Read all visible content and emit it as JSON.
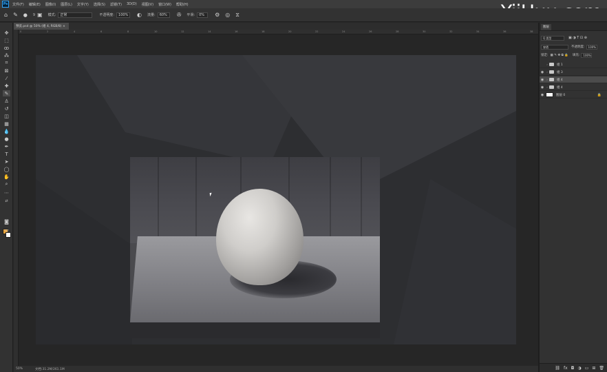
{
  "watermark": "YiiHuu.com",
  "menu": [
    "文件(F)",
    "编辑(E)",
    "图像(I)",
    "图层(L)",
    "文字(Y)",
    "选择(S)",
    "滤镜(T)",
    "3D(D)",
    "视图(V)",
    "窗口(W)",
    "帮助(H)"
  ],
  "options": {
    "brush_size": "9",
    "mode_label": "模式:",
    "mode_value": "正常",
    "opacity_label": "不透明度:",
    "opacity_value": "100%",
    "flow_label": "流量:",
    "flow_value": "60%",
    "smooth_label": "平滑:",
    "smooth_value": "0%"
  },
  "document_tab": "预览.psd @ 50% (组 4, RGB/8) ×",
  "ruler_ticks": [
    "0",
    "2",
    "4",
    "6",
    "8",
    "10",
    "12",
    "14",
    "16",
    "18",
    "20",
    "22",
    "24",
    "26",
    "28",
    "30",
    "32",
    "34",
    "36",
    "38"
  ],
  "status": {
    "zoom": "50%",
    "doc_size": "文档:31.2M/261.1M"
  },
  "layers_panel": {
    "tab_label": "图层",
    "filter_label": "Q 类型",
    "blend_mode": "穿透",
    "opacity_label": "不透明度:",
    "opacity_value": "100%",
    "lock_label": "锁定:",
    "fill_label": "填充:",
    "fill_value": "100%",
    "layers": [
      {
        "name": "组 1",
        "type": "group",
        "visible": false,
        "selected": false
      },
      {
        "name": "组 3",
        "type": "group",
        "visible": true,
        "selected": false
      },
      {
        "name": "组 4",
        "type": "group",
        "visible": true,
        "selected": true
      },
      {
        "name": "组 4",
        "type": "group",
        "visible": true,
        "selected": false
      },
      {
        "name": "图层 0",
        "type": "layer",
        "visible": true,
        "selected": false,
        "locked": true
      }
    ]
  },
  "colors": {
    "foreground": "#e8a33a",
    "background": "#ffffff",
    "accent": "#31a8ff"
  }
}
